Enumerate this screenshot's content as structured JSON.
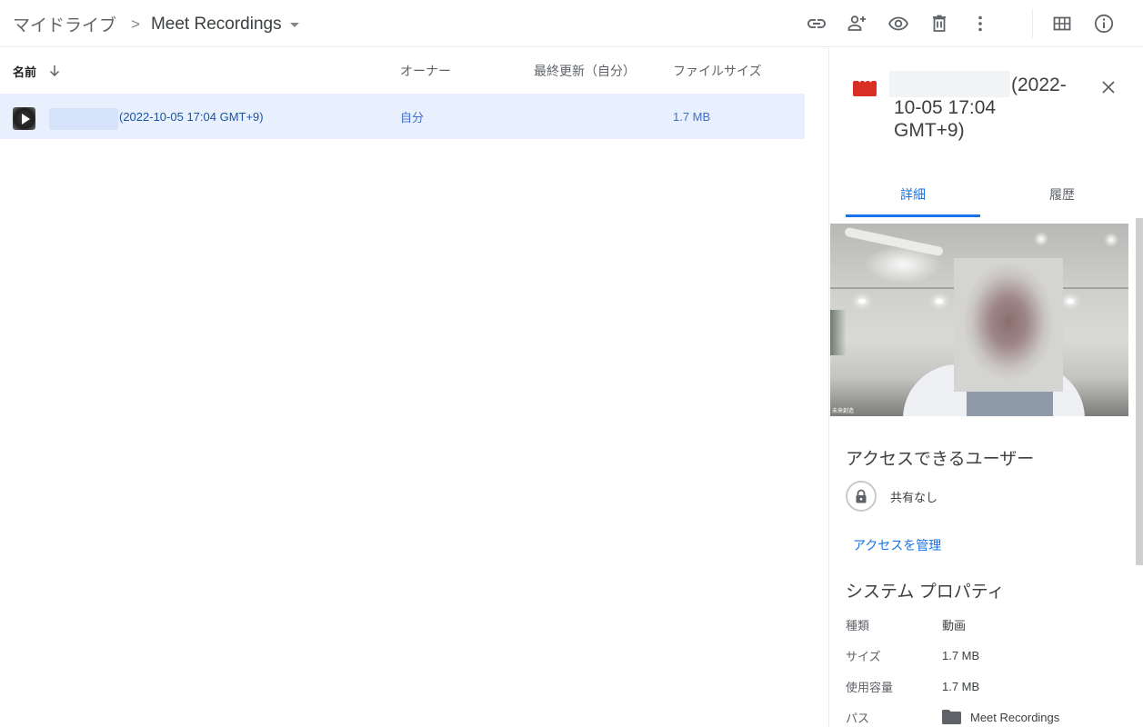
{
  "breadcrumb": {
    "root": "マイドライブ",
    "separator": ">",
    "current": "Meet Recordings"
  },
  "toolbar": {
    "buttons": [
      {
        "name": "get-link",
        "icon": "link-icon"
      },
      {
        "name": "share",
        "icon": "person-add-icon"
      },
      {
        "name": "preview",
        "icon": "eye-icon"
      },
      {
        "name": "delete",
        "icon": "trash-icon"
      },
      {
        "name": "more-actions",
        "icon": "more-vert-icon"
      },
      {
        "name": "grid-view",
        "icon": "grid-icon"
      },
      {
        "name": "view-details",
        "icon": "info-icon"
      }
    ]
  },
  "list": {
    "columns": {
      "name": "名前",
      "owner": "オーナー",
      "modified": "最終更新（自分）",
      "size": "ファイルサイズ"
    },
    "sort": "name-ascending",
    "rows": [
      {
        "name": "(2022-10-05 17:04 GMT+9)",
        "owner": "自分",
        "modified": "",
        "size": "1.7 MB",
        "selected": true,
        "type": "video"
      }
    ]
  },
  "details": {
    "title": "(2022-10-05 17:04 GMT+9)",
    "tabs": [
      "詳細",
      "履歴"
    ],
    "active_tab": "詳細",
    "preview_caption": "未来創造",
    "access": {
      "heading": "アクセスできるユーザー",
      "status": "共有なし",
      "manage_link": "アクセスを管理"
    },
    "properties": {
      "heading": "システム プロパティ",
      "items": [
        {
          "key": "種類",
          "value": "動画"
        },
        {
          "key": "サイズ",
          "value": "1.7 MB"
        },
        {
          "key": "使用容量",
          "value": "1.7 MB"
        },
        {
          "key": "パス",
          "value": "Meet Recordings"
        }
      ]
    }
  },
  "colors": {
    "accent": "#1a73e8",
    "selected_row": "#e8f0fe",
    "video_icon": "#d93025",
    "icon": "#5f6368"
  }
}
